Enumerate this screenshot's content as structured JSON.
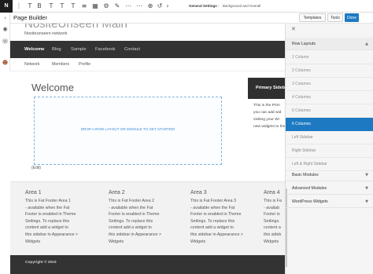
{
  "toolbar": {
    "logo_label": "N",
    "icons": [
      "vertical-dots-icon",
      "text-t-icon",
      "bold-icon",
      "text-t-icon",
      "text-t-icon",
      "text-t-icon",
      "list-icon",
      "grid-icon",
      "gear-icon",
      "edit-icon",
      "more-icon",
      "plus-circle-icon",
      "undo-icon",
      "chevron-right-icon"
    ],
    "breadcrumbs": [
      "General Settings",
      "Background and Overall"
    ],
    "separator": "›"
  },
  "rail": {
    "icons": [
      "chevron-left-icon",
      "eye-icon",
      "wordpress-icon",
      "avatar-icon"
    ]
  },
  "builder": {
    "title": "Page Builder",
    "templates_label": "Templates",
    "tools_label": "Tools",
    "done_label": "Done"
  },
  "site": {
    "title": "NositeUnseen Main",
    "tagline": "Nositeunseen network",
    "main_nav": [
      "Welcome",
      "Blog",
      "Sample",
      "Facebook",
      "Contact"
    ],
    "sub_nav": [
      "Network",
      "Members",
      "Profile"
    ],
    "page_heading": "Welcome",
    "drop_text": "DROP A ROW LAYOUT OR MODULE TO GET STARTED!",
    "edit_link": "(Edit)",
    "sidebar_title": "Primary Sidebar",
    "sidebar_lines": [
      "This is the Prim",
      "you can add wid",
      "visiting your Wi",
      "new widgets to this"
    ],
    "footer_areas": [
      {
        "title": "Area 1",
        "lines": [
          "This is Fat Footer Area 1",
          "- available when the Fat",
          "Footer is enabled in Theme",
          "Settings. To replace this",
          "content add a widget to",
          "this sidebar in Appearance >",
          "Widgets"
        ]
      },
      {
        "title": "Area 2",
        "lines": [
          "This is Fat Footer Area 2",
          "- available when the Fat",
          "Footer is enabled in Theme",
          "Settings. To replace this",
          "content add a widget to",
          "this sidebar in Appearance >",
          "Widgets"
        ]
      },
      {
        "title": "Area 3",
        "lines": [
          "This is Fat Footer Area 3",
          "- available when the Fat",
          "Footer is enabled in Theme",
          "Settings. To replace this",
          "content add a widget to",
          "this sidebar in Appearance >",
          "Widgets"
        ]
      },
      {
        "title": "Area 4",
        "lines": [
          "This is Fa",
          "- availab",
          "Footer is",
          "Settings.",
          "content a",
          "this sideb",
          "Widgets"
        ]
      }
    ],
    "copyright": "Copyright © 2015"
  },
  "panel": {
    "close_icon": "close-icon",
    "row_layouts_label": "Row Layouts",
    "row_items": [
      "1 Column",
      "2 Columns",
      "3 Columns",
      "4 Columns",
      "5 Columns",
      "6 Columns",
      "Left Sidebar",
      "Right Sidebar",
      "Left & Right Sidebar"
    ],
    "selected_row": "6 Columns",
    "other_groups": [
      "Basic Modules",
      "Advanced Modules",
      "WordPress Widgets"
    ],
    "chevron_up": "▲",
    "chevron_down": "▼"
  },
  "colors": {
    "accent": "#1d7ac2",
    "nav_dark": "#333333",
    "footer_bg": "#f2f2f2",
    "dropzone_border": "#7fb2e5"
  }
}
